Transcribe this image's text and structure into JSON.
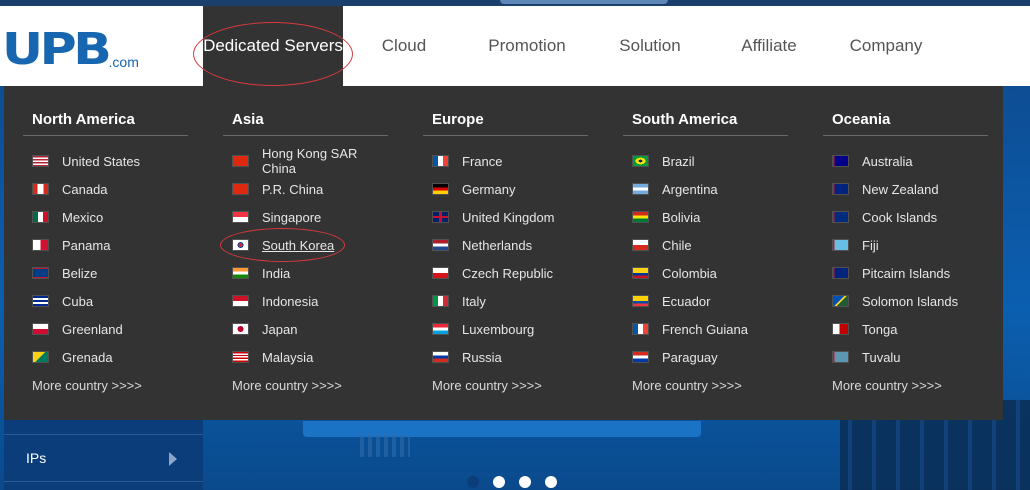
{
  "logo": {
    "mark": "UPB",
    "suffix": ".com"
  },
  "nav": [
    {
      "label": "Dedicated Servers",
      "active": true
    },
    {
      "label": "Cloud"
    },
    {
      "label": "Promotion"
    },
    {
      "label": "Solution"
    },
    {
      "label": "Affiliate"
    },
    {
      "label": "Company"
    }
  ],
  "regions": [
    {
      "title": "North America",
      "countries": [
        {
          "name": "United States",
          "flag": "us"
        },
        {
          "name": "Canada",
          "flag": "ca"
        },
        {
          "name": "Mexico",
          "flag": "mx"
        },
        {
          "name": "Panama",
          "flag": "pa"
        },
        {
          "name": "Belize",
          "flag": "bz"
        },
        {
          "name": "Cuba",
          "flag": "cu"
        },
        {
          "name": "Greenland",
          "flag": "gl"
        },
        {
          "name": "Grenada",
          "flag": "gd"
        }
      ],
      "more": "More country >>>>"
    },
    {
      "title": "Asia",
      "countries": [
        {
          "name": "Hong Kong SAR China",
          "flag": "hk"
        },
        {
          "name": "P.R. China",
          "flag": "cn"
        },
        {
          "name": "Singapore",
          "flag": "sg"
        },
        {
          "name": "South Korea",
          "flag": "kr",
          "highlighted": true
        },
        {
          "name": "India",
          "flag": "in"
        },
        {
          "name": "Indonesia",
          "flag": "id"
        },
        {
          "name": "Japan",
          "flag": "jp"
        },
        {
          "name": "Malaysia",
          "flag": "my"
        }
      ],
      "more": "More country >>>>"
    },
    {
      "title": "Europe",
      "countries": [
        {
          "name": "France",
          "flag": "fr"
        },
        {
          "name": "Germany",
          "flag": "de"
        },
        {
          "name": "United Kingdom",
          "flag": "gb"
        },
        {
          "name": "Netherlands",
          "flag": "nl"
        },
        {
          "name": "Czech Republic",
          "flag": "cz"
        },
        {
          "name": "Italy",
          "flag": "it"
        },
        {
          "name": "Luxembourg",
          "flag": "lu"
        },
        {
          "name": "Russia",
          "flag": "ru"
        }
      ],
      "more": "More country >>>>"
    },
    {
      "title": "South America",
      "countries": [
        {
          "name": "Brazil",
          "flag": "br"
        },
        {
          "name": "Argentina",
          "flag": "ar"
        },
        {
          "name": "Bolivia",
          "flag": "bo"
        },
        {
          "name": "Chile",
          "flag": "cl"
        },
        {
          "name": "Colombia",
          "flag": "co"
        },
        {
          "name": "Ecuador",
          "flag": "ec"
        },
        {
          "name": "French Guiana",
          "flag": "gf"
        },
        {
          "name": "Paraguay",
          "flag": "py"
        }
      ],
      "more": "More country >>>>"
    },
    {
      "title": "Oceania",
      "countries": [
        {
          "name": "Australia",
          "flag": "au"
        },
        {
          "name": "New Zealand",
          "flag": "nz"
        },
        {
          "name": "Cook Islands",
          "flag": "ck"
        },
        {
          "name": "Fiji",
          "flag": "fj"
        },
        {
          "name": "Pitcairn Islands",
          "flag": "pn"
        },
        {
          "name": "Solomon Islands",
          "flag": "sb"
        },
        {
          "name": "Tonga",
          "flag": "to"
        },
        {
          "name": "Tuvalu",
          "flag": "tv"
        }
      ],
      "more": "More country >>>>"
    }
  ],
  "side_menu": {
    "item_label": "IPs"
  },
  "carousel": {
    "slides": 4,
    "active_index": 0
  },
  "colors": {
    "brand": "#1666b0",
    "dropdown_bg": "#333333",
    "highlight": "#d63a3a"
  }
}
